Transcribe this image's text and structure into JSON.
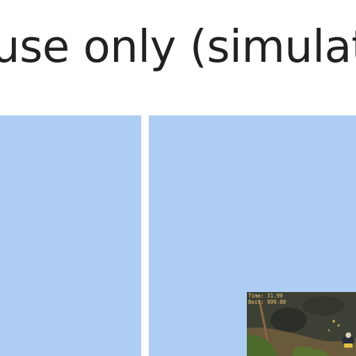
{
  "header": {
    "headline": "use only (simulat"
  },
  "game": {
    "hud": {
      "time_label": "Time:",
      "time_value": "31.99",
      "best_label": "Best:",
      "best_value": "999.00"
    }
  },
  "colors": {
    "accent_ring": "#19a88a",
    "panel_bg": "#aecdf3",
    "headline_text": "#222222",
    "hud_text": "#f0c27a"
  }
}
